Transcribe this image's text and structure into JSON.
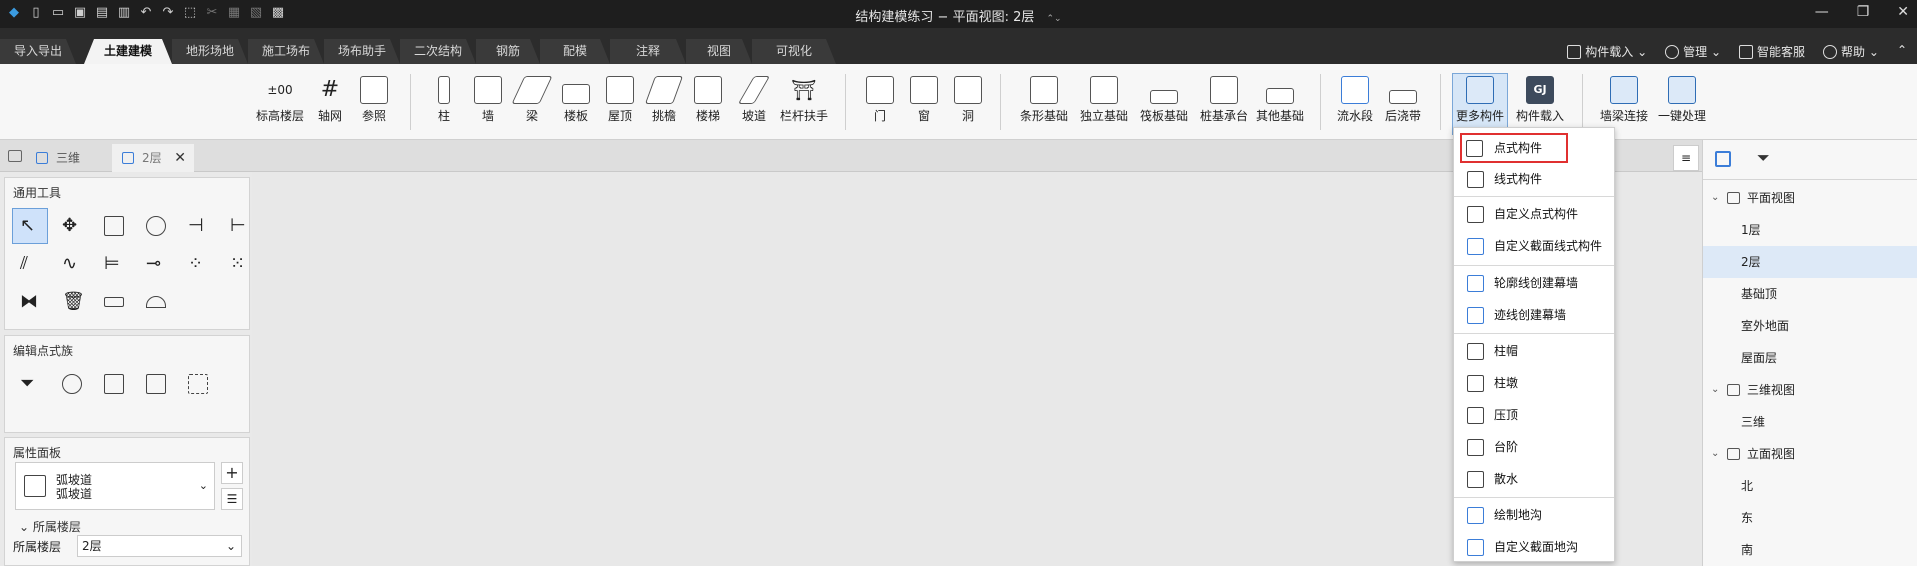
{
  "window": {
    "title": "结构建模练习 − 平面视图: 2层",
    "title_caret": "⌃⌄"
  },
  "menu_tabs": [
    "导入导出",
    "土建建模",
    "地形场地",
    "施工场布",
    "场布助手",
    "二次结构",
    "钢筋",
    "配模",
    "注释",
    "视图",
    "可视化"
  ],
  "active_tab_index": 1,
  "top_right": {
    "component_load": "构件载入",
    "manage": "管理",
    "service": "智能客服",
    "help": "帮助"
  },
  "ribbon": {
    "tools": [
      "标高楼层",
      "轴网",
      "参照",
      "柱",
      "墙",
      "梁",
      "楼板",
      "屋顶",
      "挑檐",
      "楼梯",
      "坡道",
      "栏杆扶手",
      "门",
      "窗",
      "洞",
      "条形基础",
      "独立基础",
      "筏板基础",
      "桩基承台",
      "其他基础",
      "流水段",
      "后浇带",
      "更多构件",
      "构件载入",
      "墙梁连接",
      "一键处理"
    ],
    "elevation_icon_text": "±00"
  },
  "doc_tabs": [
    {
      "label": "三维"
    },
    {
      "label": "2层"
    }
  ],
  "left_panels": {
    "common_tools_title": "通用工具",
    "edit_point_family_title": "编辑点式族",
    "property_panel_title": "属性面板",
    "property_type_line1": "弧坡道",
    "property_type_line2": "弧坡道",
    "section_label": "所属楼层",
    "floor_label": "所属楼层",
    "floor_value": "2层"
  },
  "dropdown": {
    "items": [
      "点式构件",
      "线式构件",
      "自定义点式构件",
      "自定义截面线式构件",
      "轮廓线创建幕墙",
      "迹线创建幕墙",
      "柱帽",
      "柱墩",
      "压顶",
      "台阶",
      "散水",
      "绘制地沟",
      "自定义截面地沟"
    ],
    "highlighted_index": 0
  },
  "tree": {
    "plan_views": "平面视图",
    "plan_children": [
      "1层",
      "2层",
      "基础顶",
      "室外地面",
      "屋面层"
    ],
    "selected": "2层",
    "view_3d": "三维视图",
    "view_3d_children": [
      "三维"
    ],
    "elevation_views": "立面视图",
    "elevation_children": [
      "北",
      "东",
      "南"
    ]
  },
  "colors": {
    "accent": "#3b7dd8",
    "highlight_border": "#e03030",
    "selection": "#dde9f7"
  }
}
